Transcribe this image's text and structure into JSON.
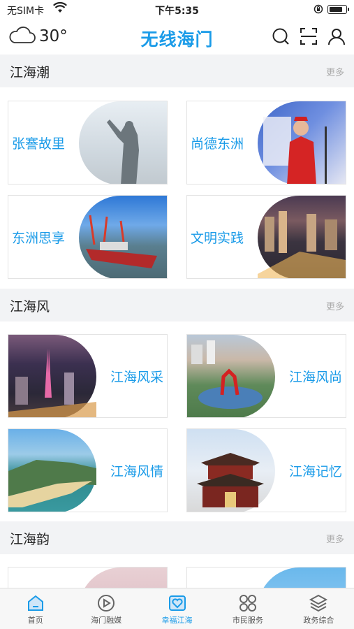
{
  "status_bar": {
    "carrier": "无SIM卡",
    "time": "下午5:35"
  },
  "header": {
    "temperature": "30°",
    "app_title": "无线海门"
  },
  "sections": [
    {
      "title": "江海潮",
      "more": "更多",
      "cards": [
        {
          "label": "张謇故里",
          "image": "statue-photo"
        },
        {
          "label": "尚德东洲",
          "image": "volunteer-photo"
        },
        {
          "label": "东洲思享",
          "image": "shipyard-photo"
        },
        {
          "label": "文明实践",
          "image": "city-night-photo"
        }
      ]
    },
    {
      "title": "江海风",
      "more": "更多",
      "cards": [
        {
          "label": "江海风采",
          "image": "tower-night-photo"
        },
        {
          "label": "江海风尚",
          "image": "plaza-sculpture-photo"
        },
        {
          "label": "江海风情",
          "image": "coastline-photo"
        },
        {
          "label": "江海记忆",
          "image": "temple-gate-photo"
        }
      ]
    },
    {
      "title": "江海韵",
      "more": "更多",
      "cards": []
    }
  ],
  "tabbar": [
    {
      "label": "首页",
      "icon": "home-icon",
      "active": false
    },
    {
      "label": "海门融媒",
      "icon": "media-play-icon",
      "active": false
    },
    {
      "label": "幸福江海",
      "icon": "heart-icon",
      "active": true
    },
    {
      "label": "市民服务",
      "icon": "services-grid-icon",
      "active": false
    },
    {
      "label": "政务综合",
      "icon": "layers-icon",
      "active": false
    }
  ],
  "colors": {
    "accent": "#1a9be8",
    "section_bg": "#f2f3f5"
  }
}
